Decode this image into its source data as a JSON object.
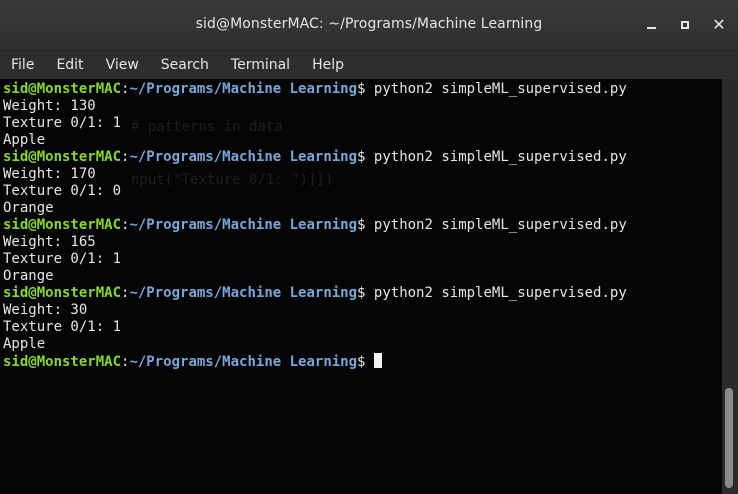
{
  "window": {
    "title": "sid@MonsterMAC: ~/Programs/Machine Learning",
    "buttons": {
      "minimize": "minimize",
      "maximize": "maximize",
      "close": "close"
    }
  },
  "menu": {
    "items": [
      "File",
      "Edit",
      "View",
      "Search",
      "Terminal",
      "Help"
    ]
  },
  "prompt": {
    "user": "sid@MonsterMAC",
    "colon": ":",
    "path": "~/Programs/Machine Learning",
    "dollar": "$"
  },
  "terminal": {
    "runs": [
      {
        "command": "python2 simpleML_supervised.py",
        "weight": "Weight: 130",
        "texture": "Texture 0/1: 1",
        "result": "Apple"
      },
      {
        "command": "python2 simpleML_supervised.py",
        "weight": "Weight: 170",
        "texture": "Texture 0/1: 0",
        "result": "Orange"
      },
      {
        "command": "python2 simpleML_supervised.py",
        "weight": "Weight: 165",
        "texture": "Texture 0/1: 1",
        "result": "Orange"
      },
      {
        "command": "python2 simpleML_supervised.py",
        "weight": "Weight: 30",
        "texture": "Texture 0/1: 1",
        "result": "Apple"
      }
    ]
  },
  "background_text": {
    "line1": "# patterns in data",
    "line2": "nput(\"Texture 0/1: \")]])"
  }
}
